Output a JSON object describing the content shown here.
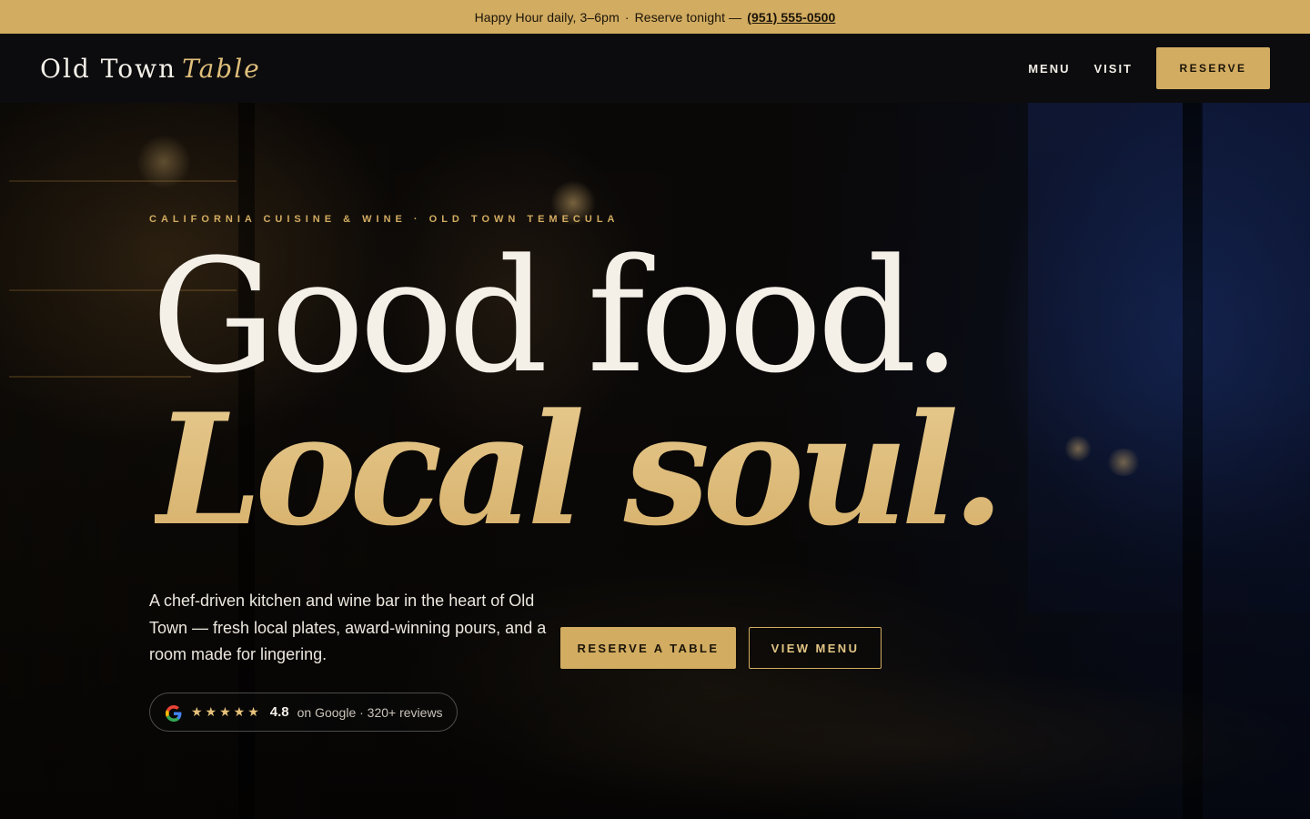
{
  "announcement": {
    "text": "Happy Hour daily, 3–6pm",
    "separator": "·",
    "cta_text": "Reserve tonight —",
    "phone": "(951) 555-0500"
  },
  "header": {
    "logo_main": "Old Town",
    "logo_accent": "Table",
    "nav": [
      {
        "label": "MENU"
      },
      {
        "label": "VISIT"
      }
    ],
    "reserve_label": "RESERVE"
  },
  "hero": {
    "eyebrow": "CALIFORNIA CUISINE & WINE · OLD TOWN TEMECULA",
    "headline_line1": "Good food.",
    "headline_line2": "Local soul.",
    "lede": "A chef-driven kitchen and wine bar in the heart of Old Town — fresh local plates, award-winning pours, and a room made for lingering.",
    "primary_cta": "RESERVE A TABLE",
    "secondary_cta": "VIEW MENU",
    "rating": {
      "icon": "google-icon",
      "stars": "★★★★★",
      "score": "4.8",
      "source": "on Google · 320+ reviews"
    }
  },
  "colors": {
    "accent_gold": "#d2ac61",
    "headline_gold": "#dcbb78",
    "header_bg": "#0c0c0e",
    "text_light": "#f4efe7"
  }
}
